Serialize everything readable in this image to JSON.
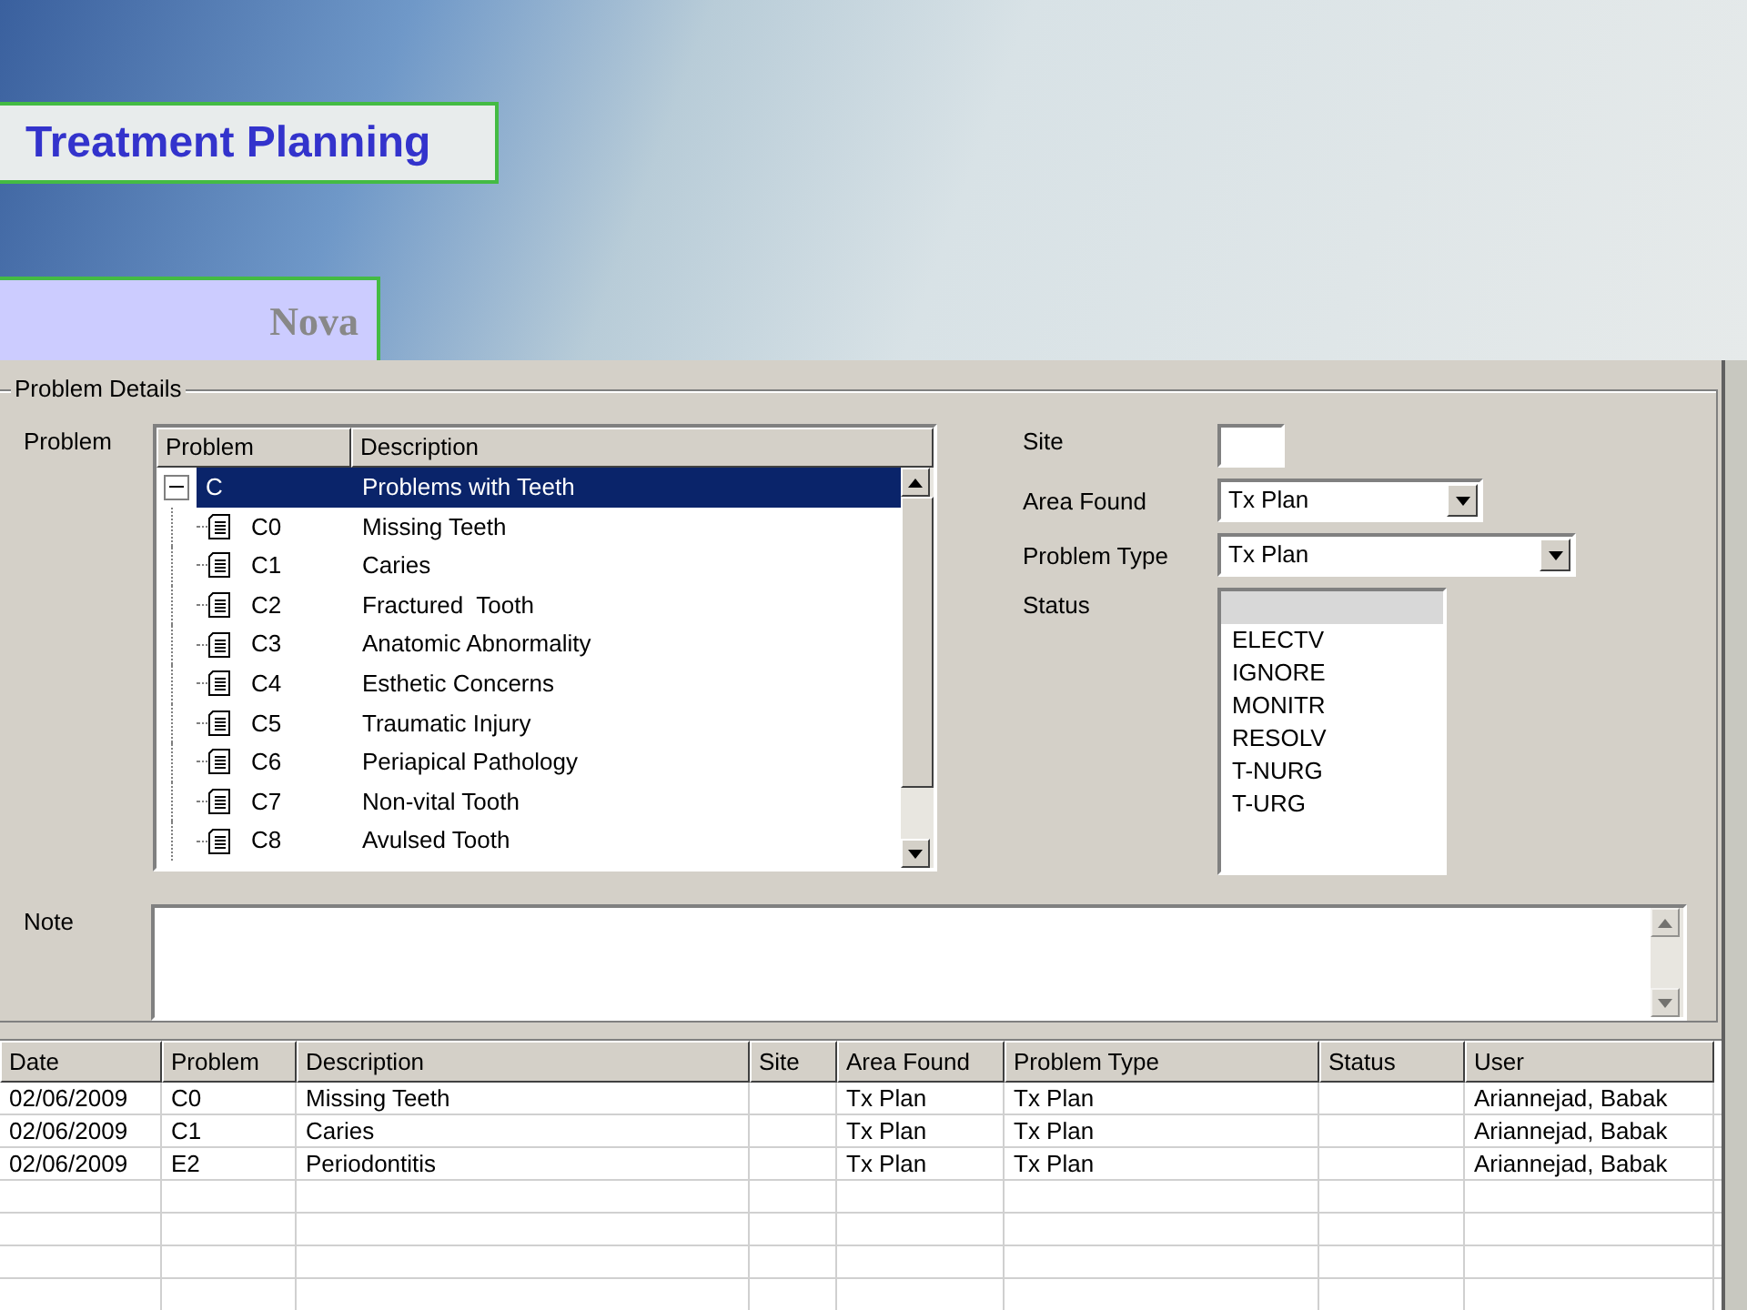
{
  "slide": {
    "title": "Treatment Planning",
    "subtitle": "Nova"
  },
  "problem_details": {
    "group_title": "Problem Details",
    "problem_label": "Problem",
    "tree": {
      "columns": [
        "Problem",
        "Description"
      ],
      "rows": [
        {
          "code": "C",
          "description": "Problems with Teeth",
          "selected": true,
          "expanded": true,
          "children": [
            {
              "code": "C0",
              "description": "Missing Teeth",
              "selected": false
            },
            {
              "code": "C1",
              "description": "Caries",
              "selected": false
            },
            {
              "code": "C2",
              "description": "Fractured  Tooth",
              "selected": false
            },
            {
              "code": "C3",
              "description": "Anatomic Abnormality",
              "selected": false
            },
            {
              "code": "C4",
              "description": "Esthetic Concerns",
              "selected": false
            },
            {
              "code": "C5",
              "description": "Traumatic Injury",
              "selected": false
            },
            {
              "code": "C6",
              "description": "Periapical Pathology",
              "selected": false
            },
            {
              "code": "C7",
              "description": "Non-vital Tooth",
              "selected": false
            },
            {
              "code": "C8",
              "description": "Avulsed Tooth",
              "selected": false
            }
          ]
        }
      ]
    },
    "site": {
      "label": "Site"
    },
    "area_found": {
      "label": "Area Found",
      "value": "Tx Plan"
    },
    "problem_type": {
      "label": "Problem Type",
      "value": "Tx Plan"
    },
    "status": {
      "label": "Status",
      "options": [
        {
          "label": "ELECTV",
          "selected": false
        },
        {
          "label": "IGNORE",
          "selected": false
        },
        {
          "label": "MONITR",
          "selected": false
        },
        {
          "label": "RESOLV",
          "selected": false
        },
        {
          "label": "T-NURG",
          "selected": false
        },
        {
          "label": "T-URG",
          "selected": false
        }
      ]
    },
    "note": {
      "label": "Note"
    }
  },
  "grid": {
    "columns": [
      "Date",
      "Problem",
      "Description",
      "Site",
      "Area Found",
      "Problem Type",
      "Status",
      "User"
    ],
    "rows": [
      {
        "date": "02/06/2009",
        "problem": "C0",
        "description": "Missing Teeth",
        "area_found": "Tx Plan",
        "problem_type": "Tx Plan",
        "user": "Ariannejad, Babak"
      },
      {
        "date": "02/06/2009",
        "problem": "C1",
        "description": "Caries",
        "area_found": "Tx Plan",
        "problem_type": "Tx Plan",
        "user": "Ariannejad, Babak"
      },
      {
        "date": "02/06/2009",
        "problem": "E2",
        "description": "Periodontitis",
        "area_found": "Tx Plan",
        "problem_type": "Tx Plan",
        "user": "Ariannejad, Babak"
      }
    ]
  }
}
